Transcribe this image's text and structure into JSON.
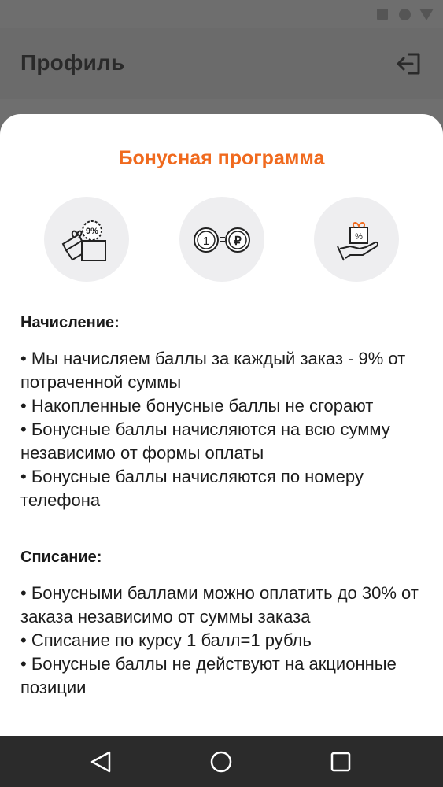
{
  "status_bar": {
    "icons": [
      "square-icon",
      "circle-icon",
      "triangle-icon"
    ]
  },
  "app_bar": {
    "title": "Профиль",
    "logout_icon": "logout-icon"
  },
  "sheet": {
    "title": "Бонусная программа",
    "icons": [
      {
        "name": "gift-box-percent-icon",
        "badge": "9%"
      },
      {
        "name": "coin-equals-ruble-icon",
        "left": "1",
        "right": "₽"
      },
      {
        "name": "hand-gift-percent-icon",
        "badge": "%"
      }
    ],
    "accrual": {
      "heading": "Начисление:",
      "items": [
        "• Мы начисляем баллы за каждый заказ - 9% от потраченной суммы",
        "• Накопленные бонусные баллы не сгорают",
        "• Бонусные баллы начисляются на всю сумму независимо от формы оплаты",
        "• Бонусные баллы начисляются по номеру телефона"
      ]
    },
    "writeoff": {
      "heading": "Списание:",
      "items": [
        "• Бонусными баллами можно оплатить до 30% от заказа независимо от суммы заказа",
        "• Списание по курсу 1 балл=1 рубль",
        "• Бонусные баллы не действуют на акционные позиции"
      ]
    }
  },
  "nav_bar": {
    "icons": [
      "back-icon",
      "home-icon",
      "recents-icon"
    ]
  },
  "colors": {
    "accent": "#f06a1e",
    "scrim": "#6f6f6f",
    "navbar": "#2b2b2b",
    "icon_bg": "#eeeef0"
  }
}
